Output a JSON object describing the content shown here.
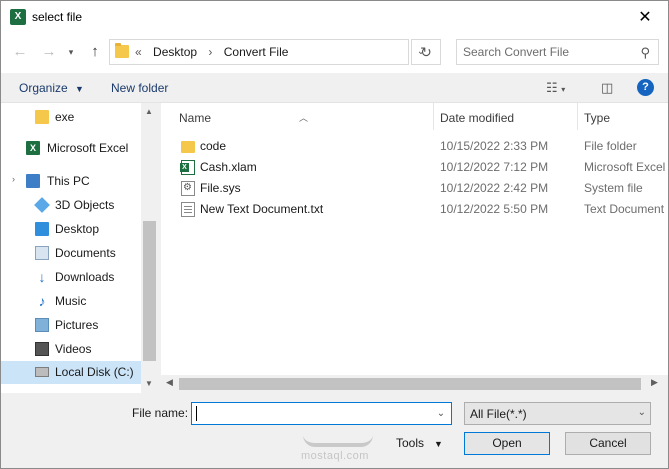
{
  "window": {
    "title": "select file",
    "app_icon": "excel-icon"
  },
  "navigation": {
    "back_icon": "arrow-left-icon",
    "forward_icon": "arrow-right-icon",
    "recent_icon": "chevron-down-icon",
    "up_icon": "arrow-up-icon",
    "breadcrumb": [
      "Desktop",
      "Convert File"
    ],
    "overflow": "«",
    "refresh_icon": "refresh-icon",
    "search_placeholder": "Search Convert File"
  },
  "toolbar": {
    "organize": "Organize",
    "new_folder": "New folder"
  },
  "sidebar": {
    "items": [
      {
        "label": "exe",
        "icon": "folder-icon"
      },
      {
        "label": "Microsoft Excel",
        "icon": "excel-icon"
      },
      {
        "label": "This PC",
        "icon": "computer-icon"
      },
      {
        "label": "3D Objects",
        "icon": "cube-icon"
      },
      {
        "label": "Desktop",
        "icon": "desktop-icon"
      },
      {
        "label": "Documents",
        "icon": "documents-icon"
      },
      {
        "label": "Downloads",
        "icon": "download-icon"
      },
      {
        "label": "Music",
        "icon": "music-icon"
      },
      {
        "label": "Pictures",
        "icon": "pictures-icon"
      },
      {
        "label": "Videos",
        "icon": "videos-icon"
      },
      {
        "label": "Local Disk (C:)",
        "icon": "disk-icon"
      }
    ],
    "selected": "Local Disk (C:)"
  },
  "file_list": {
    "columns": [
      "Name",
      "Date modified",
      "Type"
    ],
    "rows": [
      {
        "name": "code",
        "date": "10/15/2022 2:33 PM",
        "type": "File folder",
        "icon": "folder-icon"
      },
      {
        "name": "Cash.xlam",
        "date": "10/12/2022 7:12 PM",
        "type": "Microsoft Excel",
        "icon": "excel-file-icon"
      },
      {
        "name": "File.sys",
        "date": "10/12/2022 2:42 PM",
        "type": "System file",
        "icon": "system-file-icon"
      },
      {
        "name": "New Text Document.txt",
        "date": "10/12/2022 5:50 PM",
        "type": "Text Document",
        "icon": "text-file-icon"
      }
    ]
  },
  "footer": {
    "file_name_label": "File name:",
    "file_name_value": "",
    "filter": "All File(*.*)",
    "tools": "Tools",
    "open": "Open",
    "cancel": "Cancel"
  },
  "watermark": {
    "text": "mostaql.com"
  }
}
